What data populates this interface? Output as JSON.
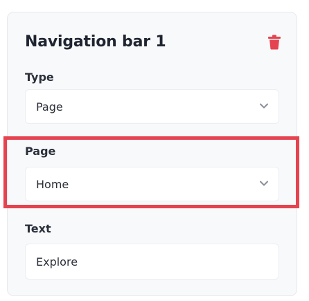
{
  "panel": {
    "title": "Navigation bar 1",
    "delete_icon": "trash-icon",
    "fields": {
      "type": {
        "label": "Type",
        "value": "Page",
        "icon": "chevron-down-icon"
      },
      "page": {
        "label": "Page",
        "value": "Home",
        "icon": "chevron-down-icon"
      },
      "text": {
        "label": "Text",
        "value": "Explore"
      }
    }
  },
  "colors": {
    "delete_icon": "#e5434f",
    "highlight_border": "#e5434f",
    "panel_bg": "#f8f9fb",
    "chevron": "#8a8f99"
  }
}
